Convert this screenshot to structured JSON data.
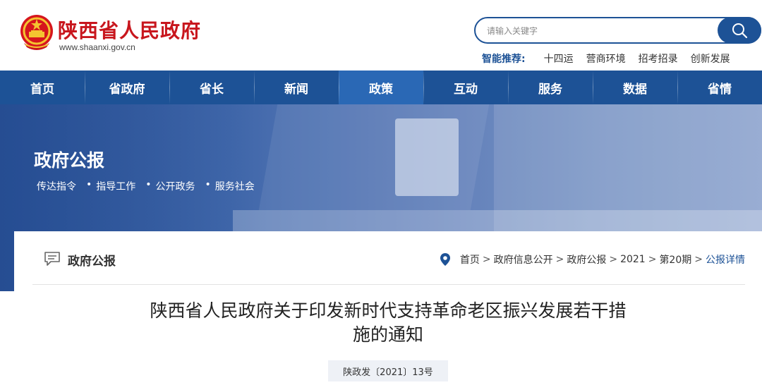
{
  "header": {
    "site_title": "陕西省人民政府",
    "site_url": "www.shaanxi.gov.cn",
    "search": {
      "placeholder": "请输入关键字"
    },
    "recommend": {
      "label": "智能推荐:",
      "items": [
        "十四运",
        "营商环境",
        "招考招录",
        "创新发展"
      ]
    }
  },
  "nav": {
    "items": [
      {
        "label": "首页"
      },
      {
        "label": "省政府"
      },
      {
        "label": "省长"
      },
      {
        "label": "新闻"
      },
      {
        "label": "政策"
      },
      {
        "label": "互动"
      },
      {
        "label": "服务"
      },
      {
        "label": "数据"
      },
      {
        "label": "省情"
      }
    ],
    "active": "政策"
  },
  "banner": {
    "title": "政府公报",
    "links": [
      "传达指令",
      "指导工作",
      "公开政务",
      "服务社会"
    ]
  },
  "card": {
    "title": "政府公报",
    "breadcrumb": [
      "首页",
      "政府信息公开",
      "政府公报",
      "2021",
      "第20期"
    ],
    "breadcrumb_current": "公报详情"
  },
  "article": {
    "title_line1": "陕西省人民政府关于印发新时代支持革命老区振兴发展若干措",
    "title_line2": "施的通知",
    "doc_number": "陕政发〔2021〕13号"
  },
  "colors": {
    "brand_red": "#c8161d",
    "nav_blue": "#1d5296",
    "nav_active": "#2a68b5"
  }
}
